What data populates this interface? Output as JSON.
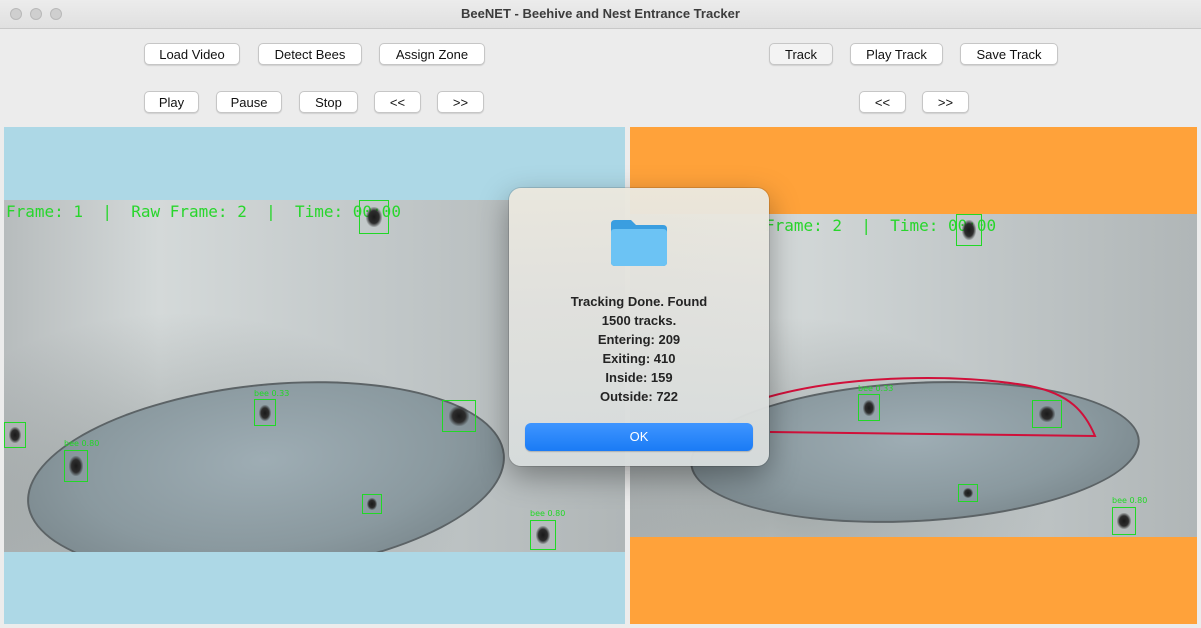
{
  "window": {
    "title": "BeeNET - Beehive and Nest Entrance Tracker"
  },
  "toolbar": {
    "load_video": "Load Video",
    "detect_bees": "Detect Bees",
    "assign_zone": "Assign Zone",
    "track": "Track",
    "play_track": "Play Track",
    "save_track": "Save Track",
    "play": "Play",
    "pause": "Pause",
    "stop": "Stop",
    "rewind": "<<",
    "forward": ">>",
    "track_rewind": "<<",
    "track_forward": ">>"
  },
  "colors": {
    "left_panel_bg": "#add8e6",
    "right_panel_bg": "#ffa23a",
    "overlay_text": "#28d62c",
    "zone_line": "#d0103a",
    "ok_button": "#1a7bf5"
  },
  "left_panel": {
    "overlay": "Frame: 1  |  Raw Frame: 2  |  Time: 00:00",
    "detections": [
      "bee 0.33",
      "bee 0.80",
      "bee 0.80",
      "bee 0.80",
      "bee 0.80"
    ]
  },
  "right_panel": {
    "overlay": "Frame: 2  |  Time: 00:00",
    "detections": [
      "bee 0.33",
      "bee 0.80",
      "bee 0.80",
      "bee 0.80"
    ]
  },
  "dialog": {
    "icon": "folder-icon",
    "lines": [
      "Tracking Done. Found",
      "1500 tracks.",
      "Entering: 209",
      "Exiting: 410",
      "Inside: 159",
      "Outside: 722"
    ],
    "ok_label": "OK"
  }
}
